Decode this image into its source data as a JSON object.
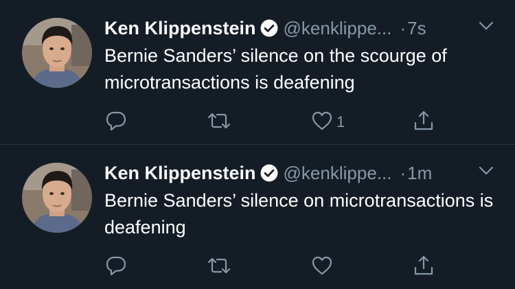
{
  "tweets": [
    {
      "author_name": "Ken Klippenstein",
      "handle": "@kenklippe...",
      "dot": "·",
      "time": "7s",
      "text": "Bernie Sanders’ silence on the scourge of microtransactions is deafening",
      "like_count": "1",
      "avatar_icon": "user-avatar-photo",
      "verified_icon": "verified-badge-icon"
    },
    {
      "author_name": "Ken Klippenstein",
      "handle": "@kenklippe...",
      "dot": "·",
      "time": "1m",
      "text": "Bernie Sanders’ silence on microtransactions is deafening",
      "like_count": "",
      "avatar_icon": "user-avatar-photo",
      "verified_icon": "verified-badge-icon"
    }
  ],
  "icons": [
    "reply-icon",
    "retweet-icon",
    "like-icon",
    "share-icon",
    "chevron-down-icon"
  ],
  "colors": {
    "background": "#141d26",
    "text": "#ffffff",
    "secondary": "#8899a6",
    "divider": "#253341"
  }
}
